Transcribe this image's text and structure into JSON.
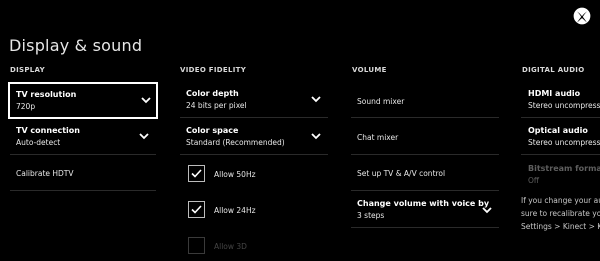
{
  "page": {
    "title": "Display & sound",
    "logo_icon": "xbox-logo-icon"
  },
  "sections": {
    "display": "DISPLAY",
    "video_fidelity": "VIDEO FIDELITY",
    "volume": "VOLUME",
    "digital_audio": "DIGITAL AUDIO"
  },
  "display": {
    "tv_resolution": {
      "title": "TV resolution",
      "value": "720p"
    },
    "tv_connection": {
      "title": "TV connection",
      "value": "Auto-detect"
    },
    "calibrate": {
      "label": "Calibrate HDTV"
    }
  },
  "video_fidelity": {
    "color_depth": {
      "title": "Color depth",
      "value": "24 bits per pixel"
    },
    "color_space": {
      "title": "Color space",
      "value": "Standard (Recommended)"
    },
    "allow_50hz": {
      "label": "Allow 50Hz",
      "checked": true
    },
    "allow_24hz": {
      "label": "Allow 24Hz",
      "checked": true
    },
    "allow_3d": {
      "label": "Allow 3D",
      "checked": false,
      "enabled": false
    }
  },
  "volume": {
    "sound_mixer": "Sound mixer",
    "chat_mixer": "Chat mixer",
    "setup_av": "Set up TV & A/V control",
    "voice_volume": {
      "title": "Change volume with voice by",
      "value": "3 steps"
    }
  },
  "digital_audio": {
    "hdmi_audio": {
      "title": "HDMI audio",
      "value": "Stereo uncompress"
    },
    "optical_audio": {
      "title": "Optical audio",
      "value": "Stereo uncompress"
    },
    "bitstream_format": {
      "title": "Bitstream format",
      "value": "Off",
      "enabled": false
    },
    "help_lines": [
      "If you change your au",
      "sure to recalibrate yo",
      "Settings > Kinect > Ki"
    ]
  },
  "colors": {
    "background": "#000000",
    "text": "#ffffff",
    "divider": "#2a2a2a",
    "disabled": "#5e5e5e"
  }
}
